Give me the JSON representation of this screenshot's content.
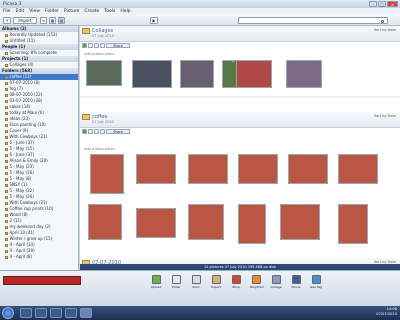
{
  "window": {
    "title": "Picasa 3"
  },
  "menu": [
    "File",
    "Edit",
    "View",
    "Folder",
    "Picture",
    "Create",
    "Tools",
    "Help"
  ],
  "toolbar": {
    "import_label": "Import"
  },
  "sidebar": {
    "sections": [
      {
        "label": "Albums (2)",
        "items": [
          "Recently Updated (153)",
          "Untitled (11)"
        ]
      },
      {
        "label": "People (1)",
        "items": [
          "Scanning: 8% complete"
        ]
      },
      {
        "label": "Projects (1)",
        "items": [
          "Collages (4)"
        ]
      },
      {
        "label": "Folders (568)",
        "items": [
          "coffee (12)",
          "07-07-2010 (8)",
          "fog (7)",
          "08-07-2010 (22)",
          "03-07-2010 (28)",
          "cakes (14)",
          "today at Maui (6)",
          "ideas (23)",
          "Face painting (10)",
          "Cover (9)",
          "With Cowboys (21)",
          "6 - June (37)",
          "5 - May (15)",
          "6 - June (37)",
          "Alison & Emily (20)",
          "5 - May (23)",
          "5 - May (16)",
          "5 - May (8)",
          "SNSY (1)",
          "5 - May (32)",
          "5 - May (26)",
          "With Cowboys (21)",
          "Coffee cup prints (10)",
          "Wood (8)",
          "2 (11)",
          "my weekend day (2)",
          "April 10 (41)",
          "Winter / grow up (15)",
          "4 - April (14)",
          "4 - April (29)",
          "4 - April (8)"
        ]
      }
    ]
  },
  "folders": [
    {
      "title": "Collages",
      "date": "07 July 2010",
      "desc": "Add a description"
    },
    {
      "title": "coffee",
      "date": "07 July 2010",
      "desc": "Add a description"
    },
    {
      "title": "07-07-2010",
      "date": "07 July 2010"
    }
  ],
  "sort_label": "Sort by Date",
  "share_label": "Share",
  "status": "12 pictures  07 July 2010  399.4KB on disk",
  "tray_buttons": [
    "Upload",
    "Email",
    "Print",
    "Export",
    "Shop",
    "BlogThis!",
    "Collage",
    "Movie",
    "Geo-Tag"
  ],
  "clock": {
    "time": "14:08",
    "date": "07/07/2010"
  }
}
